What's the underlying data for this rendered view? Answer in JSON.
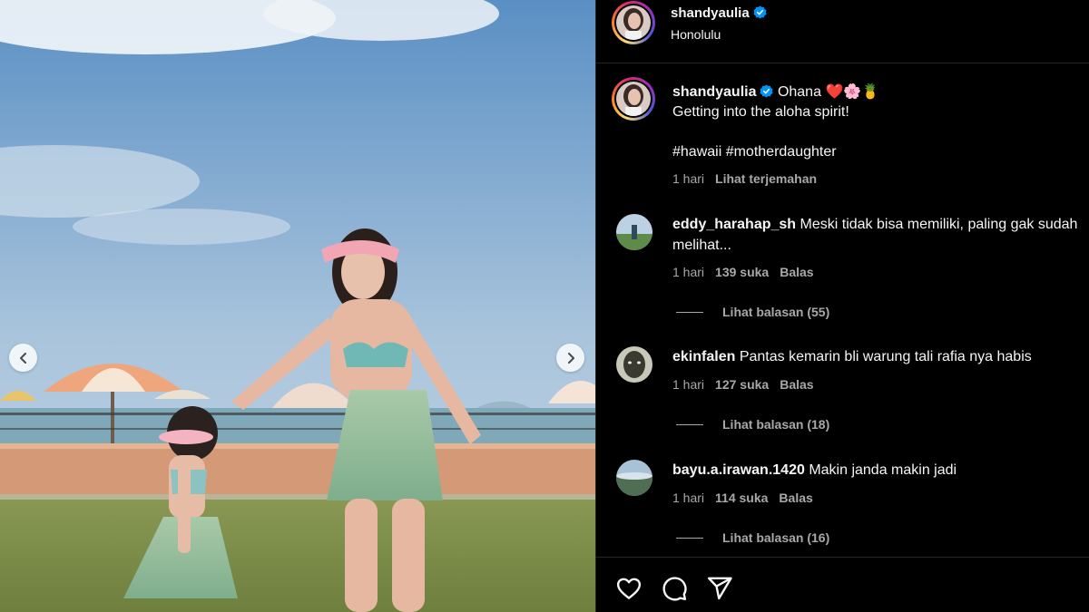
{
  "post": {
    "username": "shandyaulia",
    "location": "Honolulu",
    "verified": true
  },
  "caption": {
    "username": "shandyaulia",
    "title": "Ohana",
    "emojis": "❤️🌸🍍",
    "line2": "Getting into the aloha spirit!",
    "hashtags": "#hawaii #motherdaughter",
    "time": "1 hari",
    "translate": "Lihat terjemahan"
  },
  "comments": [
    {
      "username": "eddy_harahap_sh",
      "text": "Meski tidak bisa memiliki, paling gak sudah melihat...",
      "time": "1 hari",
      "likes": "139 suka",
      "reply": "Balas",
      "view_replies": "Lihat balasan (55)"
    },
    {
      "username": "ekinfalen",
      "text": "Pantas kemarin bli warung tali rafia nya habis",
      "time": "1 hari",
      "likes": "127 suka",
      "reply": "Balas",
      "view_replies": "Lihat balasan (18)"
    },
    {
      "username": "bayu.a.irawan.1420",
      "text": "Makin janda makin jadi",
      "time": "1 hari",
      "likes": "114 suka",
      "reply": "Balas",
      "view_replies": "Lihat balasan (16)"
    }
  ],
  "actions": {
    "like_icon": "heart-icon",
    "comment_icon": "comment-icon",
    "share_icon": "share-icon"
  },
  "colors": {
    "background": "#000000",
    "text_primary": "#f5f5f5",
    "text_secondary": "#a8a8a8",
    "divider": "#262626",
    "verified": "#0095f6"
  }
}
